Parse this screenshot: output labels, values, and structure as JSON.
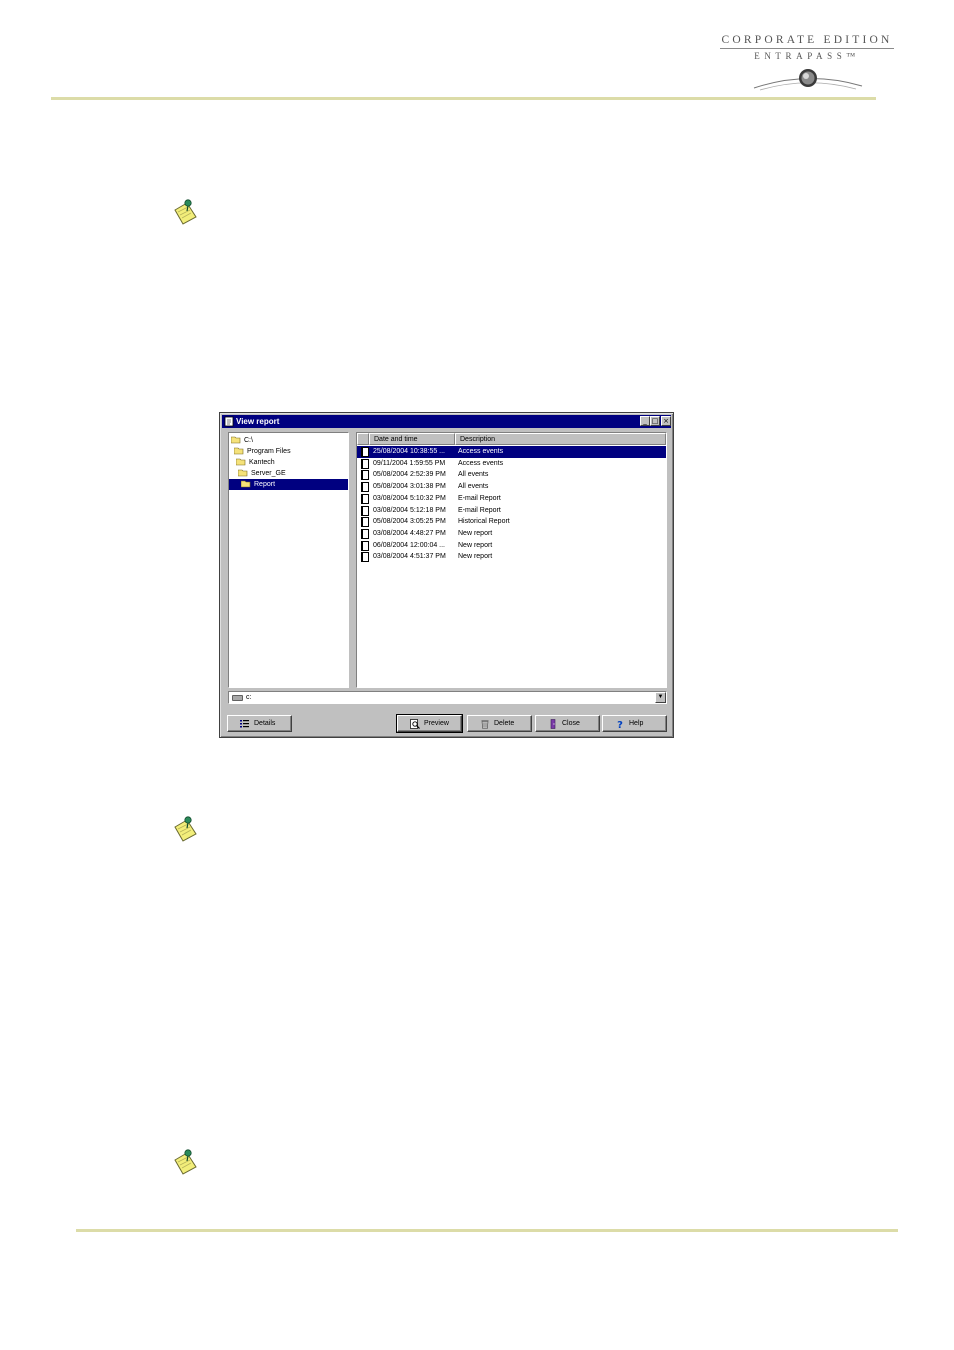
{
  "header": {
    "logo_line1": "CORPORATE EDITION",
    "logo_line2": "ENTRAPASS™"
  },
  "colors": {
    "rule": "#dcdca8",
    "titlebar": "#000080",
    "window_face": "#c0c0c0",
    "note_icon": "#f2ee7a"
  },
  "notes": [
    {
      "icon": "note-icon"
    },
    {
      "icon": "note-icon"
    },
    {
      "icon": "note-icon"
    }
  ],
  "window": {
    "title": "View report",
    "title_buttons": [
      "_",
      "□",
      "×"
    ],
    "tree": [
      {
        "label": "C:\\",
        "icon": "open-folder-icon"
      },
      {
        "label": "Program Files",
        "icon": "open-folder-icon"
      },
      {
        "label": "Kantech",
        "icon": "open-folder-icon"
      },
      {
        "label": "Server_GE",
        "icon": "open-folder-icon"
      },
      {
        "label": "Report",
        "icon": "open-folder-icon",
        "selected": true
      }
    ],
    "list": {
      "columns": [
        "",
        "Date and time",
        "Description"
      ],
      "rows": [
        {
          "date": "25/08/2004 10:38:55 ...",
          "description": "Access events",
          "selected": true
        },
        {
          "date": "09/11/2004 1:59:55 PM",
          "description": "Access events"
        },
        {
          "date": "05/08/2004 2:52:39 PM",
          "description": "All events"
        },
        {
          "date": "05/08/2004 3:01:38 PM",
          "description": "All events"
        },
        {
          "date": "03/08/2004 5:10:32 PM",
          "description": "E-mail Report"
        },
        {
          "date": "03/08/2004 5:12:18 PM",
          "description": "E-mail Report"
        },
        {
          "date": "05/08/2004 3:05:25 PM",
          "description": "Historical Report"
        },
        {
          "date": "03/08/2004 4:48:27 PM",
          "description": "New report"
        },
        {
          "date": "06/08/2004 12:00:04 ...",
          "description": "New report"
        },
        {
          "date": "03/08/2004 4:51:37 PM",
          "description": "New report"
        }
      ]
    },
    "drive": {
      "value": "c:",
      "icon": "drive-icon"
    },
    "buttons": {
      "details": "Details",
      "preview": "Preview",
      "delete": "Delete",
      "close": "Close",
      "help": "Help"
    }
  }
}
